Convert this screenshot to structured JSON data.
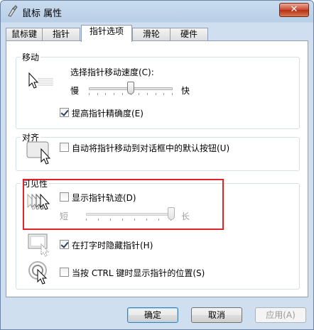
{
  "window": {
    "title": "鼠标 属性",
    "close_label": "✕"
  },
  "tabs": [
    {
      "label": "鼠标键"
    },
    {
      "label": "指针"
    },
    {
      "label": "指针选项"
    },
    {
      "label": "滑轮"
    },
    {
      "label": "硬件"
    }
  ],
  "motion": {
    "title": "移动",
    "speed_label": "选择指针移动速度(C):",
    "slow_label": "慢",
    "fast_label": "快",
    "speed_value_fraction": 0.5,
    "precision_label": "提高指针精确度(E)",
    "precision_checked": true
  },
  "snap": {
    "title": "对齐",
    "snap_label": "自动将指针移动到对话框中的默认按钮(U)",
    "snap_checked": false
  },
  "visibility": {
    "title": "可见性",
    "trails_label": "显示指针轨迹(D)",
    "trails_checked": false,
    "short_label": "短",
    "long_label": "长",
    "trails_value_fraction": 1.0,
    "hide_label": "在打字时隐藏指针(H)",
    "hide_checked": true,
    "ctrl_label": "当按 CTRL 键时显示指针的位置(S)",
    "ctrl_checked": false
  },
  "buttons": {
    "ok": "确定",
    "cancel": "取消",
    "apply": "应用(A)"
  },
  "colors": {
    "highlight": "#e0232b",
    "accent": "#3c7fb1"
  }
}
